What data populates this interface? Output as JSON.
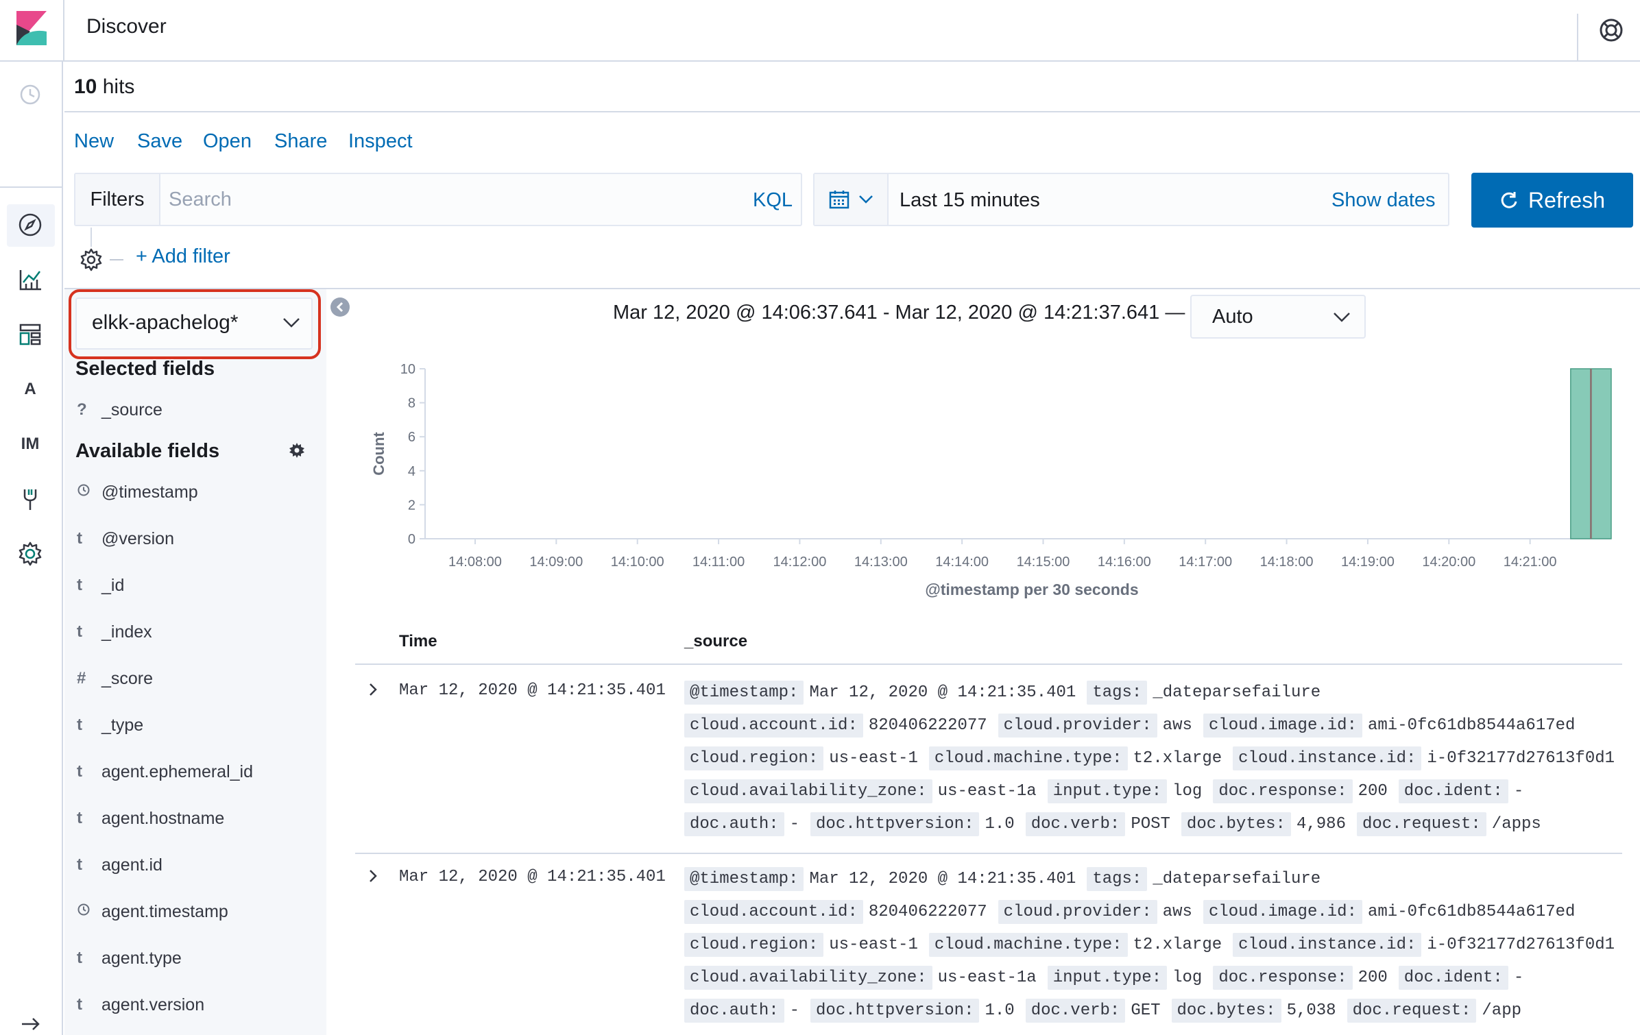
{
  "header": {
    "title": "Discover"
  },
  "hits": {
    "count": "10",
    "label": "hits"
  },
  "menu": [
    "New",
    "Save",
    "Open",
    "Share",
    "Inspect"
  ],
  "query": {
    "filters_label": "Filters",
    "search_placeholder": "Search",
    "kql": "KQL",
    "date_value": "Last 15 minutes",
    "show_dates": "Show dates",
    "refresh": "Refresh",
    "add_filter": "+ Add filter"
  },
  "sidebar": {
    "index_pattern": "elkk-apachelog*",
    "selected_heading": "Selected fields",
    "selected_fields": [
      {
        "type": "?",
        "name": "_source"
      }
    ],
    "available_heading": "Available fields",
    "available_fields": [
      {
        "type": "clock",
        "name": "@timestamp"
      },
      {
        "type": "t",
        "name": "@version"
      },
      {
        "type": "t",
        "name": "_id"
      },
      {
        "type": "t",
        "name": "_index"
      },
      {
        "type": "#",
        "name": "_score"
      },
      {
        "type": "t",
        "name": "_type"
      },
      {
        "type": "t",
        "name": "agent.ephemeral_id"
      },
      {
        "type": "t",
        "name": "agent.hostname"
      },
      {
        "type": "t",
        "name": "agent.id"
      },
      {
        "type": "clock",
        "name": "agent.timestamp"
      },
      {
        "type": "t",
        "name": "agent.type"
      },
      {
        "type": "t",
        "name": "agent.version"
      }
    ]
  },
  "chart": {
    "range_label": "Mar 12, 2020 @ 14:06:37.641 - Mar 12, 2020 @ 14:21:37.641 —",
    "interval": "Auto"
  },
  "chart_data": {
    "type": "bar",
    "xlabel": "@timestamp per 30 seconds",
    "ylabel": "Count",
    "ylim": [
      0,
      10
    ],
    "yticks": [
      0,
      2,
      4,
      6,
      8,
      10
    ],
    "xticks": [
      "14:08:00",
      "14:09:00",
      "14:10:00",
      "14:11:00",
      "14:12:00",
      "14:13:00",
      "14:14:00",
      "14:15:00",
      "14:16:00",
      "14:17:00",
      "14:18:00",
      "14:19:00",
      "14:20:00",
      "14:21:00"
    ],
    "series": [
      {
        "values": [
          {
            "x": "14:21:30",
            "y": 10
          }
        ]
      }
    ],
    "bar_color": "#54b399"
  },
  "table": {
    "headers": [
      "Time",
      "_source"
    ],
    "rows": [
      {
        "time": "Mar 12, 2020 @ 14:21:35.401",
        "lines": [
          [
            [
              "@timestamp:",
              "Mar 12, 2020 @ 14:21:35.401"
            ],
            [
              "tags:",
              "_dateparsefailure"
            ]
          ],
          [
            [
              "cloud.account.id:",
              "820406222077"
            ],
            [
              "cloud.provider:",
              "aws"
            ],
            [
              "cloud.image.id:",
              "ami-0fc61db8544a617ed"
            ]
          ],
          [
            [
              "cloud.region:",
              "us-east-1"
            ],
            [
              "cloud.machine.type:",
              "t2.xlarge"
            ],
            [
              "cloud.instance.id:",
              "i-0f32177d27613f0d1"
            ]
          ],
          [
            [
              "cloud.availability_zone:",
              "us-east-1a"
            ],
            [
              "input.type:",
              "log"
            ],
            [
              "doc.response:",
              "200"
            ],
            [
              "doc.ident:",
              "-"
            ]
          ],
          [
            [
              "doc.auth:",
              "-"
            ],
            [
              "doc.httpversion:",
              "1.0"
            ],
            [
              "doc.verb:",
              "POST"
            ],
            [
              "doc.bytes:",
              "4,986"
            ],
            [
              "doc.request:",
              "/apps"
            ]
          ]
        ]
      },
      {
        "time": "Mar 12, 2020 @ 14:21:35.401",
        "lines": [
          [
            [
              "@timestamp:",
              "Mar 12, 2020 @ 14:21:35.401"
            ],
            [
              "tags:",
              "_dateparsefailure"
            ]
          ],
          [
            [
              "cloud.account.id:",
              "820406222077"
            ],
            [
              "cloud.provider:",
              "aws"
            ],
            [
              "cloud.image.id:",
              "ami-0fc61db8544a617ed"
            ]
          ],
          [
            [
              "cloud.region:",
              "us-east-1"
            ],
            [
              "cloud.machine.type:",
              "t2.xlarge"
            ],
            [
              "cloud.instance.id:",
              "i-0f32177d27613f0d1"
            ]
          ],
          [
            [
              "cloud.availability_zone:",
              "us-east-1a"
            ],
            [
              "input.type:",
              "log"
            ],
            [
              "doc.response:",
              "200"
            ],
            [
              "doc.ident:",
              "-"
            ]
          ],
          [
            [
              "doc.auth:",
              "-"
            ],
            [
              "doc.httpversion:",
              "1.0"
            ],
            [
              "doc.verb:",
              "GET"
            ],
            [
              "doc.bytes:",
              "5,038"
            ],
            [
              "doc.request:",
              "/app"
            ]
          ]
        ]
      }
    ]
  },
  "nav": {
    "items": [
      {
        "icon": "recent-clock-icon"
      },
      {
        "icon": "discover-compass-icon"
      },
      {
        "icon": "visualize-icon"
      },
      {
        "icon": "dashboard-icon"
      },
      {
        "icon": "avatar-a",
        "text": "A"
      },
      {
        "icon": "avatar-im",
        "text": "IM"
      },
      {
        "icon": "dev-tools-icon"
      },
      {
        "icon": "management-gear-icon"
      }
    ]
  }
}
